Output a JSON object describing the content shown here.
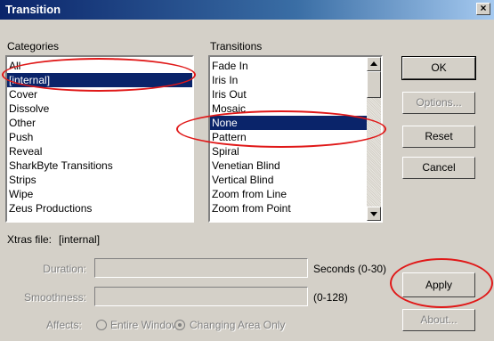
{
  "window": {
    "title": "Transition",
    "close_glyph": "×"
  },
  "categories": {
    "label": "Categories",
    "items": [
      "All",
      "[internal]",
      "Cover",
      "Dissolve",
      "Other",
      "Push",
      "Reveal",
      "SharkByte Transitions",
      "Strips",
      "Wipe",
      "Zeus Productions"
    ],
    "selected": "[internal]"
  },
  "transitions": {
    "label": "Transitions",
    "items": [
      "Fade In",
      "Iris In",
      "Iris Out",
      "Mosaic",
      "None",
      "Pattern",
      "Spiral",
      "Venetian Blind",
      "Vertical Blind",
      "Zoom from Line",
      "Zoom from Point"
    ],
    "selected": "None"
  },
  "buttons": {
    "ok": "OK",
    "options": "Options...",
    "reset": "Reset",
    "cancel": "Cancel",
    "apply": "Apply",
    "about": "About..."
  },
  "xtras": {
    "label": "Xtras file:",
    "value": "[internal]"
  },
  "duration": {
    "label": "Duration:",
    "value": "",
    "units": "Seconds (0-30)"
  },
  "smoothness": {
    "label": "Smoothness:",
    "value": "",
    "units": "(0-128)"
  },
  "affects": {
    "label": "Affects:",
    "options": [
      "Entire Window",
      "Changing Area Only"
    ],
    "selected": "Changing Area Only"
  },
  "annotation_color": "#e01818"
}
